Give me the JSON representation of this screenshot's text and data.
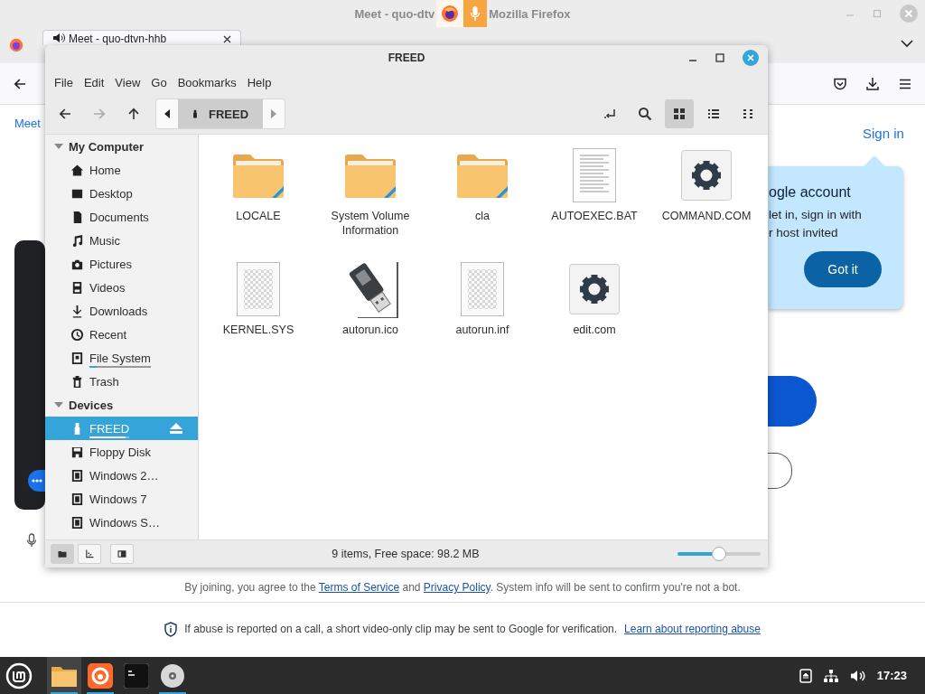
{
  "browser": {
    "title_left": "Meet - quo-dtv",
    "title_right": "Mozilla Firefox",
    "tab": {
      "label": "Meet - quo-dtvn-hhb",
      "selected": true
    },
    "page": {
      "top_link": "Meet",
      "sign_in": "Sign in",
      "popup": {
        "title": "ogle account",
        "lines": [
          "let in, sign in with",
          "r host invited"
        ],
        "button": "Got it"
      },
      "terms": {
        "before": "By joining, you agree to the ",
        "link1": "Terms of Service",
        "mid": " and ",
        "link2": "Privacy Policy",
        "after": ". System info will be sent to confirm you're not a bot."
      },
      "abuse": {
        "text": "If abuse is reported on a call, a short video-only clip may be sent to Google for verification.",
        "link": "Learn about reporting abuse"
      }
    }
  },
  "file_manager": {
    "title": "FREED",
    "menu": [
      "File",
      "Edit",
      "View",
      "Go",
      "Bookmarks",
      "Help"
    ],
    "nav": [
      {
        "kind": "back",
        "disabled": false
      },
      {
        "kind": "forward",
        "disabled": true
      },
      {
        "kind": "up",
        "disabled": false
      }
    ],
    "location": "FREED",
    "views": [
      {
        "kind": "icons",
        "selected": true
      },
      {
        "kind": "list",
        "selected": false
      },
      {
        "kind": "compact",
        "selected": false
      }
    ],
    "sidebar": [
      {
        "title": "My Computer",
        "expanded": true,
        "items": [
          {
            "label": "Home",
            "kind": "home",
            "selected": false
          },
          {
            "label": "Desktop",
            "kind": "desktop",
            "selected": false
          },
          {
            "label": "Documents",
            "kind": "documents",
            "selected": false
          },
          {
            "label": "Music",
            "kind": "music",
            "selected": false
          },
          {
            "label": "Pictures",
            "kind": "pictures",
            "selected": false
          },
          {
            "label": "Videos",
            "kind": "videos",
            "selected": false
          },
          {
            "label": "Downloads",
            "kind": "downloads",
            "selected": false
          },
          {
            "label": "Recent",
            "kind": "recent",
            "selected": false
          },
          {
            "label": "File System",
            "kind": "filesystem",
            "selected": false,
            "level": 0.12
          },
          {
            "label": "Trash",
            "kind": "trash",
            "selected": false
          }
        ]
      },
      {
        "title": "Devices",
        "expanded": true,
        "items": [
          {
            "label": "FREED",
            "kind": "usb",
            "selected": true,
            "level": 0.9,
            "ejectable": true
          },
          {
            "label": "Floppy Disk",
            "kind": "floppy",
            "selected": false
          },
          {
            "label": "Windows 2…",
            "kind": "drive",
            "selected": false
          },
          {
            "label": "Windows 7",
            "kind": "drive",
            "selected": false
          },
          {
            "label": "Windows S…",
            "kind": "drive",
            "selected": false
          }
        ]
      }
    ],
    "files": [
      {
        "name": "LOCALE",
        "kind": "folder"
      },
      {
        "name": "System Volume Information",
        "kind": "folder"
      },
      {
        "name": "cla",
        "kind": "folder"
      },
      {
        "name": "AUTOEXEC.BAT",
        "kind": "text"
      },
      {
        "name": "COMMAND.COM",
        "kind": "executable"
      },
      {
        "name": "KERNEL.SYS",
        "kind": "blank"
      },
      {
        "name": "autorun.ico",
        "kind": "usb-image"
      },
      {
        "name": "autorun.inf",
        "kind": "blank"
      },
      {
        "name": "edit.com",
        "kind": "executable"
      }
    ],
    "status_buttons": [
      {
        "kind": "places",
        "selected": true
      },
      {
        "kind": "tree",
        "selected": false
      },
      {
        "kind": "sidebar",
        "selected": false
      }
    ],
    "status": "9 items, Free space: 98.2 MB",
    "zoom": {
      "level": 0.5
    }
  },
  "taskbar": {
    "apps": [
      {
        "kind": "files",
        "selected": true,
        "running": true
      },
      {
        "kind": "firefox",
        "selected": false,
        "running": true
      },
      {
        "kind": "terminal",
        "selected": false,
        "running": false
      },
      {
        "kind": "disc",
        "selected": false,
        "running": true
      }
    ],
    "clock": "17:23"
  }
}
